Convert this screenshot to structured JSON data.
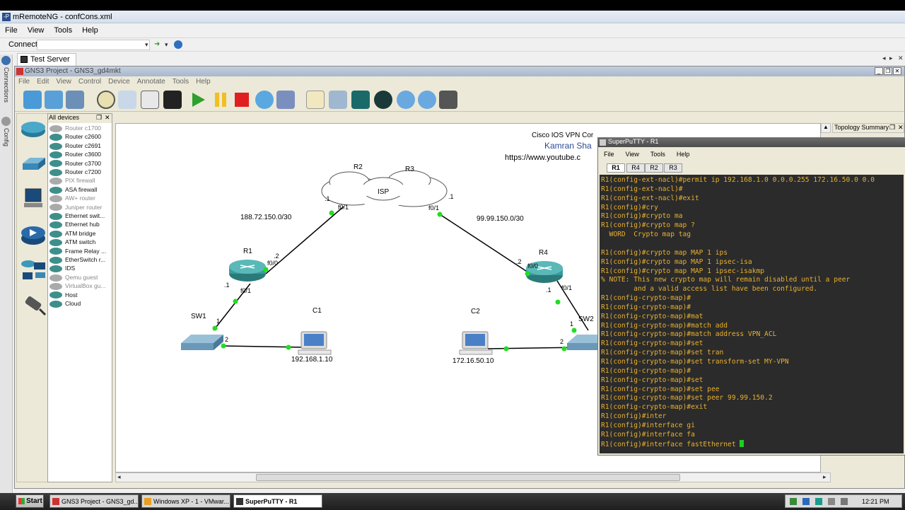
{
  "app": {
    "title": "mRemoteNG - confCons.xml"
  },
  "menubar": [
    "File",
    "View",
    "Tools",
    "Help"
  ],
  "connectbar": {
    "label": "Connect:",
    "value": ""
  },
  "sidebar": {
    "connections": "Connections",
    "config": "Config"
  },
  "tab": {
    "label": "Test Server"
  },
  "gns3": {
    "title": "GNS3 Project - GNS3_gd4mkt",
    "menu": [
      "File",
      "Edit",
      "View",
      "Control",
      "Device",
      "Annotate",
      "Tools",
      "Help"
    ],
    "devices_header": "All devices",
    "devices": [
      {
        "label": "Router c1700",
        "state": "gray"
      },
      {
        "label": "Router c2600",
        "state": "normal"
      },
      {
        "label": "Router c2691",
        "state": "normal"
      },
      {
        "label": "Router c3600",
        "state": "normal"
      },
      {
        "label": "Router c3700",
        "state": "normal"
      },
      {
        "label": "Router c7200",
        "state": "normal"
      },
      {
        "label": "PIX firewall",
        "state": "gray"
      },
      {
        "label": "ASA firewall",
        "state": "normal"
      },
      {
        "label": "AW+ router",
        "state": "gray"
      },
      {
        "label": "Juniper router",
        "state": "gray"
      },
      {
        "label": "Ethernet swit...",
        "state": "normal"
      },
      {
        "label": "Ethernet hub",
        "state": "normal"
      },
      {
        "label": "ATM bridge",
        "state": "normal"
      },
      {
        "label": "ATM switch",
        "state": "normal"
      },
      {
        "label": "Frame Relay ...",
        "state": "normal"
      },
      {
        "label": "EtherSwitch r...",
        "state": "normal"
      },
      {
        "label": "IDS",
        "state": "normal"
      },
      {
        "label": "Qemu guest",
        "state": "gray"
      },
      {
        "label": "VirtualBox gu...",
        "state": "gray"
      },
      {
        "label": "Host",
        "state": "normal"
      },
      {
        "label": "Cloud",
        "state": "normal"
      }
    ],
    "topology_summary": "Topology Summary"
  },
  "topology": {
    "banner": [
      "Cisco IOS VPN Cor",
      "Kamran Sha",
      "https://www.youtube.c"
    ],
    "cloud_label": "ISP",
    "r2": "R2",
    "r3": "R3",
    "r1": "R1",
    "r4": "R4",
    "sw1": "SW1",
    "sw2": "SW2",
    "c1": "C1",
    "c2": "C2",
    "c1_ip": "192.168.1.10",
    "c2_ip": "172.16.50.10",
    "net_left": "188.72.150.0/30",
    "net_right": "99.99.150.0/30",
    "r2_if": "f0/1",
    "r2_host": ".1",
    "r3_if": "f0/1",
    "r3_host": ".1",
    "r1_if_up": "f0/0",
    "r1_host_up": ".2",
    "r1_if_down": "f0/1",
    "r1_host_down": ".1",
    "r4_if_up": "f0/0",
    "r4_host_up": ".2",
    "r4_if_down": "f0/1",
    "r4_host_down": ".1",
    "sw1_p1": "1",
    "sw1_p2": "2",
    "sw2_p1": "1",
    "sw2_p2": "2"
  },
  "putty": {
    "title": "SuperPuTTY - R1",
    "menu": [
      "File",
      "View",
      "Tools",
      "Help"
    ],
    "tabs": [
      "R1",
      "R4",
      "R2",
      "R3"
    ],
    "lines": [
      "R1(config-ext-nacl)#permit ip 192.168.1.0 0.0.0.255 172.16.50.0 0.0",
      "R1(config-ext-nacl)#",
      "R1(config-ext-nacl)#exit",
      "R1(config)#cry",
      "R1(config)#crypto ma",
      "R1(config)#crypto map ?",
      "  WORD  Crypto map tag",
      "",
      "R1(config)#crypto map MAP 1 ips",
      "R1(config)#crypto map MAP 1 ipsec-isa",
      "R1(config)#crypto map MAP 1 ipsec-isakmp",
      "% NOTE: This new crypto map will remain disabled until a peer",
      "        and a valid access list have been configured.",
      "R1(config-crypto-map)#",
      "R1(config-crypto-map)#",
      "R1(config-crypto-map)#mat",
      "R1(config-crypto-map)#match add",
      "R1(config-crypto-map)#match address VPN_ACL",
      "R1(config-crypto-map)#set",
      "R1(config-crypto-map)#set tran",
      "R1(config-crypto-map)#set transform-set MY-VPN",
      "R1(config-crypto-map)#",
      "R1(config-crypto-map)#set",
      "R1(config-crypto-map)#set pee",
      "R1(config-crypto-map)#set peer 99.99.150.2",
      "R1(config-crypto-map)#exit",
      "R1(config)#inter",
      "R1(config)#interface gi",
      "R1(config)#interface fa",
      "R1(config)#interface fastEthernet "
    ]
  },
  "taskbar": {
    "start": "Start",
    "tasks": [
      "GNS3 Project - GNS3_gd...",
      "Windows XP - 1 - VMwar...",
      "SuperPuTTY - R1"
    ],
    "clock": "12:21 PM"
  }
}
